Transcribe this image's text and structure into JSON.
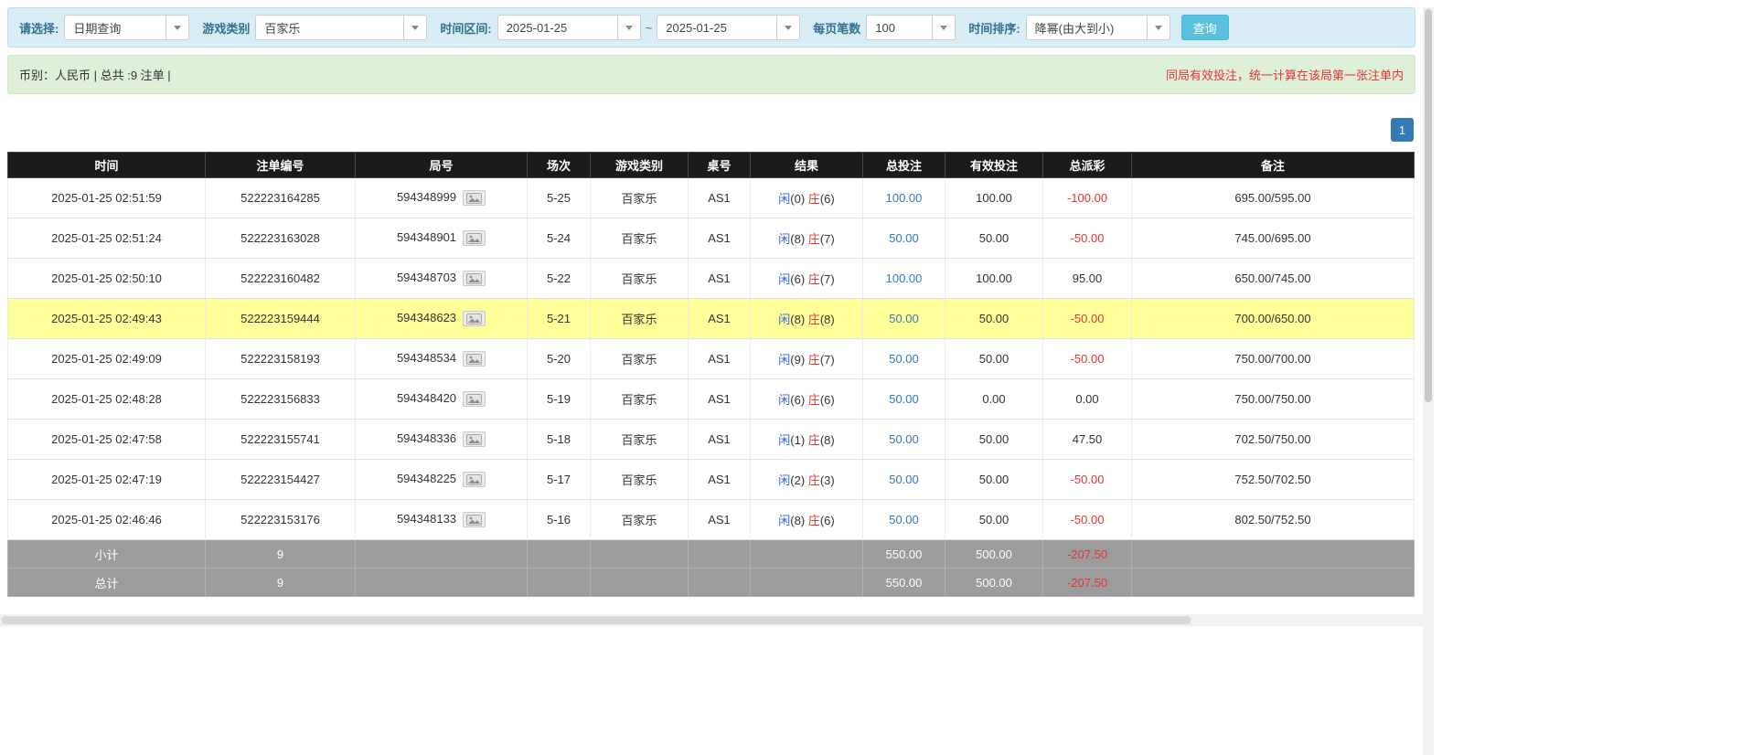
{
  "colors": {
    "filter-bg": "#d9edf7",
    "filter-border": "#b7dff0",
    "label-blue": "#31708f",
    "summary-bg": "#dff0d8",
    "summary-border": "#d0e6c0",
    "note-red": "#e53333",
    "link-blue": "#337ab7",
    "player-blue": "#3366cc",
    "banker-red": "#e53333",
    "neg-red": "#e53333",
    "header-bg": "#1b1b1b",
    "footer-bg": "#9c9c9c",
    "highlight-yellow": "#ffff99",
    "button-bg": "#5bc0de",
    "button-border": "#46b8da",
    "page-active-bg": "#337ab7"
  },
  "filters": {
    "select_label": "请选择:",
    "select_value": "日期查询",
    "game_type_label": "游戏类别",
    "game_type_value": "百家乐",
    "date_range_label": "时间区间:",
    "date_from": "2025-01-25",
    "tilde": "~",
    "date_to": "2025-01-25",
    "page_size_label": "每页笔数",
    "page_size_value": "100",
    "sort_label": "时间排序:",
    "sort_value": "降幂(由大到小)",
    "search_button": "查询"
  },
  "summary": {
    "left_text": "币别：人民币 | 总共 :9 注单 |",
    "right_note": "同局有效投注，统一计算在该局第一张注单内"
  },
  "pagination": {
    "current_page": "1"
  },
  "icons": {
    "round_detail": "picture-icon",
    "select_caret": "caret-down-icon"
  },
  "table": {
    "headers": [
      "时间",
      "注单编号",
      "局号",
      "场次",
      "游戏类别",
      "桌号",
      "结果",
      "总投注",
      "有效投注",
      "总派彩",
      "备注"
    ],
    "rows": [
      {
        "time": "2025-01-25 02:51:59",
        "bet_id": "522223164285",
        "round_id": "594348999",
        "session": "5-25",
        "game": "百家乐",
        "table": "AS1",
        "player": "闲",
        "player_score": "(0)",
        "banker": "庄",
        "banker_score": "(6)",
        "total_bet": "100.00",
        "valid_bet": "100.00",
        "payout": "-100.00",
        "note": "695.00/595.00",
        "highlight": false
      },
      {
        "time": "2025-01-25 02:51:24",
        "bet_id": "522223163028",
        "round_id": "594348901",
        "session": "5-24",
        "game": "百家乐",
        "table": "AS1",
        "player": "闲",
        "player_score": "(8)",
        "banker": "庄",
        "banker_score": "(7)",
        "total_bet": "50.00",
        "valid_bet": "50.00",
        "payout": "-50.00",
        "note": "745.00/695.00",
        "highlight": false
      },
      {
        "time": "2025-01-25 02:50:10",
        "bet_id": "522223160482",
        "round_id": "594348703",
        "session": "5-22",
        "game": "百家乐",
        "table": "AS1",
        "player": "闲",
        "player_score": "(6)",
        "banker": "庄",
        "banker_score": "(7)",
        "total_bet": "100.00",
        "valid_bet": "100.00",
        "payout": "95.00",
        "note": "650.00/745.00",
        "highlight": false
      },
      {
        "time": "2025-01-25 02:49:43",
        "bet_id": "522223159444",
        "round_id": "594348623",
        "session": "5-21",
        "game": "百家乐",
        "table": "AS1",
        "player": "闲",
        "player_score": "(8)",
        "banker": "庄",
        "banker_score": "(8)",
        "total_bet": "50.00",
        "valid_bet": "50.00",
        "payout": "-50.00",
        "note": "700.00/650.00",
        "highlight": true
      },
      {
        "time": "2025-01-25 02:49:09",
        "bet_id": "522223158193",
        "round_id": "594348534",
        "session": "5-20",
        "game": "百家乐",
        "table": "AS1",
        "player": "闲",
        "player_score": "(9)",
        "banker": "庄",
        "banker_score": "(7)",
        "total_bet": "50.00",
        "valid_bet": "50.00",
        "payout": "-50.00",
        "note": "750.00/700.00",
        "highlight": false
      },
      {
        "time": "2025-01-25 02:48:28",
        "bet_id": "522223156833",
        "round_id": "594348420",
        "session": "5-19",
        "game": "百家乐",
        "table": "AS1",
        "player": "闲",
        "player_score": "(6)",
        "banker": "庄",
        "banker_score": "(6)",
        "total_bet": "50.00",
        "valid_bet": "0.00",
        "payout": "0.00",
        "note": "750.00/750.00",
        "highlight": false
      },
      {
        "time": "2025-01-25 02:47:58",
        "bet_id": "522223155741",
        "round_id": "594348336",
        "session": "5-18",
        "game": "百家乐",
        "table": "AS1",
        "player": "闲",
        "player_score": "(1)",
        "banker": "庄",
        "banker_score": "(8)",
        "total_bet": "50.00",
        "valid_bet": "50.00",
        "payout": "47.50",
        "note": "702.50/750.00",
        "highlight": false
      },
      {
        "time": "2025-01-25 02:47:19",
        "bet_id": "522223154427",
        "round_id": "594348225",
        "session": "5-17",
        "game": "百家乐",
        "table": "AS1",
        "player": "闲",
        "player_score": "(2)",
        "banker": "庄",
        "banker_score": "(3)",
        "total_bet": "50.00",
        "valid_bet": "50.00",
        "payout": "-50.00",
        "note": "752.50/702.50",
        "highlight": false
      },
      {
        "time": "2025-01-25 02:46:46",
        "bet_id": "522223153176",
        "round_id": "594348133",
        "session": "5-16",
        "game": "百家乐",
        "table": "AS1",
        "player": "闲",
        "player_score": "(8)",
        "banker": "庄",
        "banker_score": "(6)",
        "total_bet": "50.00",
        "valid_bet": "50.00",
        "payout": "-50.00",
        "note": "802.50/752.50",
        "highlight": false
      }
    ],
    "footer": {
      "subtotal": {
        "label": "小计",
        "count": "9",
        "total_bet": "550.00",
        "valid_bet": "500.00",
        "payout": "-207.50"
      },
      "total": {
        "label": "总计",
        "count": "9",
        "total_bet": "550.00",
        "valid_bet": "500.00",
        "payout": "-207.50"
      }
    }
  }
}
